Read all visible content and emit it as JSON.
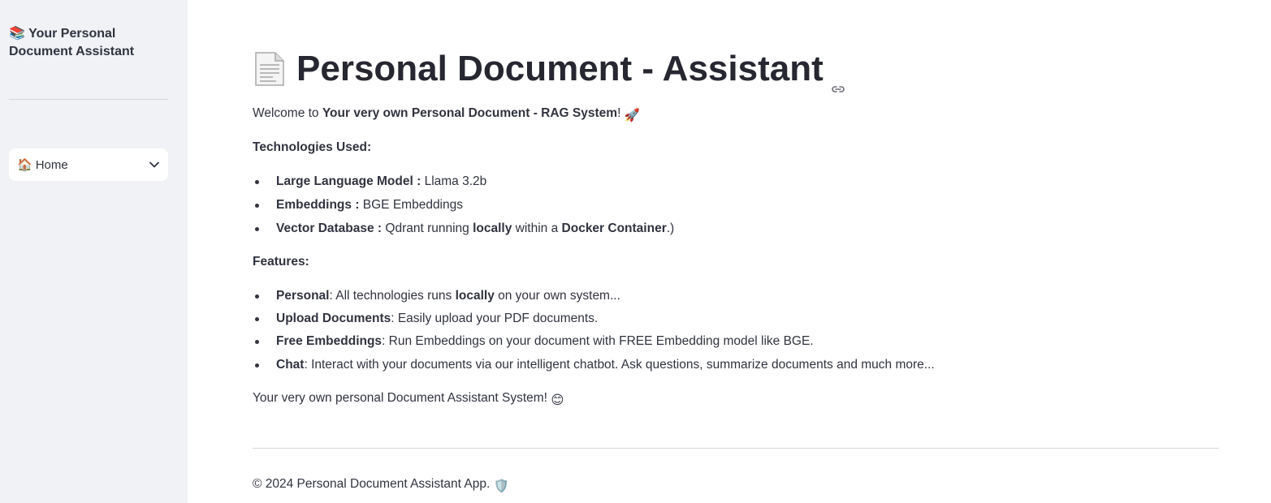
{
  "sidebar": {
    "title_emoji": "📚",
    "title": "Your Personal Document Assistant",
    "nav_select": {
      "emoji": "🏠",
      "value": "Home"
    }
  },
  "main": {
    "title": "Personal Document - Assistant",
    "welcome": {
      "prefix": "Welcome to ",
      "bold": "Your very own Personal Document - RAG System",
      "suffix": "!",
      "emoji": "🚀"
    },
    "tech_heading": "Technologies Used:",
    "technologies": [
      {
        "label": "Large Language Model :",
        "text": " Llama 3.2b"
      },
      {
        "label": "Embeddings :",
        "text": " BGE Embeddings"
      },
      {
        "label": "Vector Database :",
        "text_a": " Qdrant running ",
        "bold_a": "locally",
        "text_b": " within a ",
        "bold_b": "Docker Container",
        "text_c": ".)"
      }
    ],
    "features_heading": "Features:",
    "features": [
      {
        "label": "Personal",
        "text_a": ": All technologies runs ",
        "bold_a": "locally",
        "text_b": " on your own system..."
      },
      {
        "label": "Upload Documents",
        "text": ": Easily upload your PDF documents."
      },
      {
        "label": "Free Embeddings",
        "text": ": Run Embeddings on your document with FREE Embedding model like BGE."
      },
      {
        "label": "Chat",
        "text": ": Interact with your documents via our intelligent chatbot. Ask questions, summarize documents and much more..."
      }
    ],
    "closing": {
      "text": "Your very own personal Document Assistant System! ",
      "emoji": "😊"
    },
    "footer": {
      "text": "© 2024 Personal Document Assistant App. ",
      "emoji": "🛡️"
    }
  },
  "colors": {
    "sidebar_bg": "#f0f2f6",
    "text": "#31333f",
    "title": "#262730"
  },
  "icons": [
    "document-icon",
    "link-icon",
    "chevron-down-icon"
  ]
}
